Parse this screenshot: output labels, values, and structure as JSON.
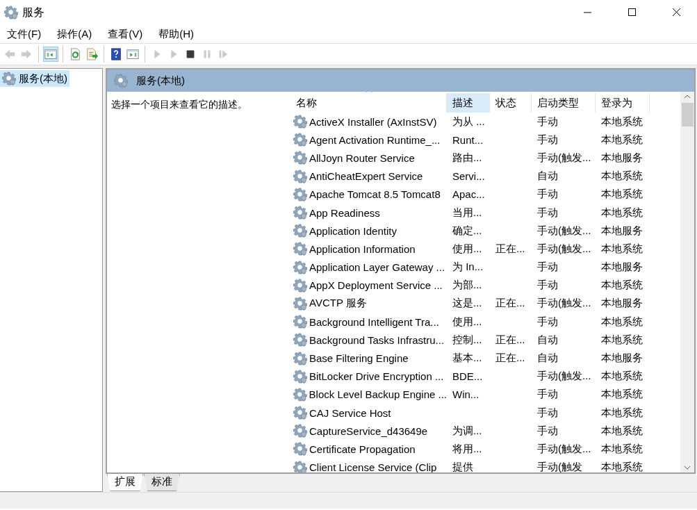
{
  "window": {
    "title": "服务"
  },
  "menu": [
    "文件(F)",
    "操作(A)",
    "查看(V)",
    "帮助(H)"
  ],
  "toolbar": [
    {
      "kind": "back",
      "disabled": true,
      "selected": false
    },
    {
      "kind": "forward",
      "disabled": true,
      "selected": false
    },
    {
      "kind": "separator"
    },
    {
      "kind": "tree",
      "disabled": false,
      "selected": true
    },
    {
      "kind": "separator"
    },
    {
      "kind": "refresh",
      "disabled": false,
      "selected": false
    },
    {
      "kind": "export",
      "disabled": false,
      "selected": false
    },
    {
      "kind": "separator"
    },
    {
      "kind": "help",
      "disabled": false,
      "selected": false
    },
    {
      "kind": "properties",
      "disabled": false,
      "selected": false
    },
    {
      "kind": "separator"
    },
    {
      "kind": "play",
      "disabled": true,
      "selected": false
    },
    {
      "kind": "play",
      "disabled": true,
      "selected": false
    },
    {
      "kind": "stop",
      "disabled": false,
      "selected": false
    },
    {
      "kind": "pause",
      "disabled": true,
      "selected": false
    },
    {
      "kind": "resume",
      "disabled": true,
      "selected": false
    }
  ],
  "tree": {
    "items": [
      {
        "label": "服务(本地)",
        "selected": true
      }
    ]
  },
  "panel": {
    "title": "服务(本地)",
    "description": "选择一个项目来查看它的描述。"
  },
  "table": {
    "columns": [
      {
        "label": "名称",
        "selected": false,
        "sorted": true
      },
      {
        "label": "描述",
        "selected": true,
        "sorted": false
      },
      {
        "label": "状态",
        "selected": false,
        "sorted": false
      },
      {
        "label": "启动类型",
        "selected": false,
        "sorted": false
      },
      {
        "label": "登录为",
        "selected": false,
        "sorted": false
      }
    ],
    "rows": [
      [
        "ActiveX Installer (AxInstSV)",
        "为从 ...",
        "",
        "手动",
        "本地系统"
      ],
      [
        "Agent Activation Runtime_...",
        "Runt...",
        "",
        "手动",
        "本地系统"
      ],
      [
        "AllJoyn Router Service",
        "路由...",
        "",
        "手动(触发...",
        "本地服务"
      ],
      [
        "AntiCheatExpert Service",
        "Servi...",
        "",
        "自动",
        "本地系统"
      ],
      [
        "Apache Tomcat 8.5 Tomcat8",
        "Apac...",
        "",
        "手动",
        "本地系统"
      ],
      [
        "App Readiness",
        "当用...",
        "",
        "手动",
        "本地系统"
      ],
      [
        "Application Identity",
        "确定...",
        "",
        "手动(触发...",
        "本地服务"
      ],
      [
        "Application Information",
        "使用...",
        "正在...",
        "手动(触发...",
        "本地系统"
      ],
      [
        "Application Layer Gateway ...",
        "为 In...",
        "",
        "手动",
        "本地服务"
      ],
      [
        "AppX Deployment Service ...",
        "为部...",
        "",
        "手动",
        "本地系统"
      ],
      [
        "AVCTP 服务",
        "这是...",
        "正在...",
        "手动(触发...",
        "本地服务"
      ],
      [
        "Background Intelligent Tra...",
        "使用...",
        "",
        "手动",
        "本地系统"
      ],
      [
        "Background Tasks Infrastru...",
        "控制...",
        "正在...",
        "自动",
        "本地系统"
      ],
      [
        "Base Filtering Engine",
        "基本...",
        "正在...",
        "自动",
        "本地服务"
      ],
      [
        "BitLocker Drive Encryption ...",
        "BDE...",
        "",
        "手动(触发...",
        "本地系统"
      ],
      [
        "Block Level Backup Engine ...",
        "Win...",
        "",
        "手动",
        "本地系统"
      ],
      [
        "CAJ Service Host",
        "",
        "",
        "手动",
        "本地系统"
      ],
      [
        "CaptureService_d43649e",
        "为调...",
        "",
        "手动",
        "本地系统"
      ],
      [
        "Certificate Propagation",
        "将用...",
        "",
        "手动(触发...",
        "本地系统"
      ],
      [
        "Client License Service (Clip",
        "提供",
        "",
        "手动(触发",
        "本地系统"
      ]
    ]
  },
  "tabs": [
    {
      "label": "扩展",
      "selected": true
    },
    {
      "label": "标准",
      "selected": false
    }
  ]
}
